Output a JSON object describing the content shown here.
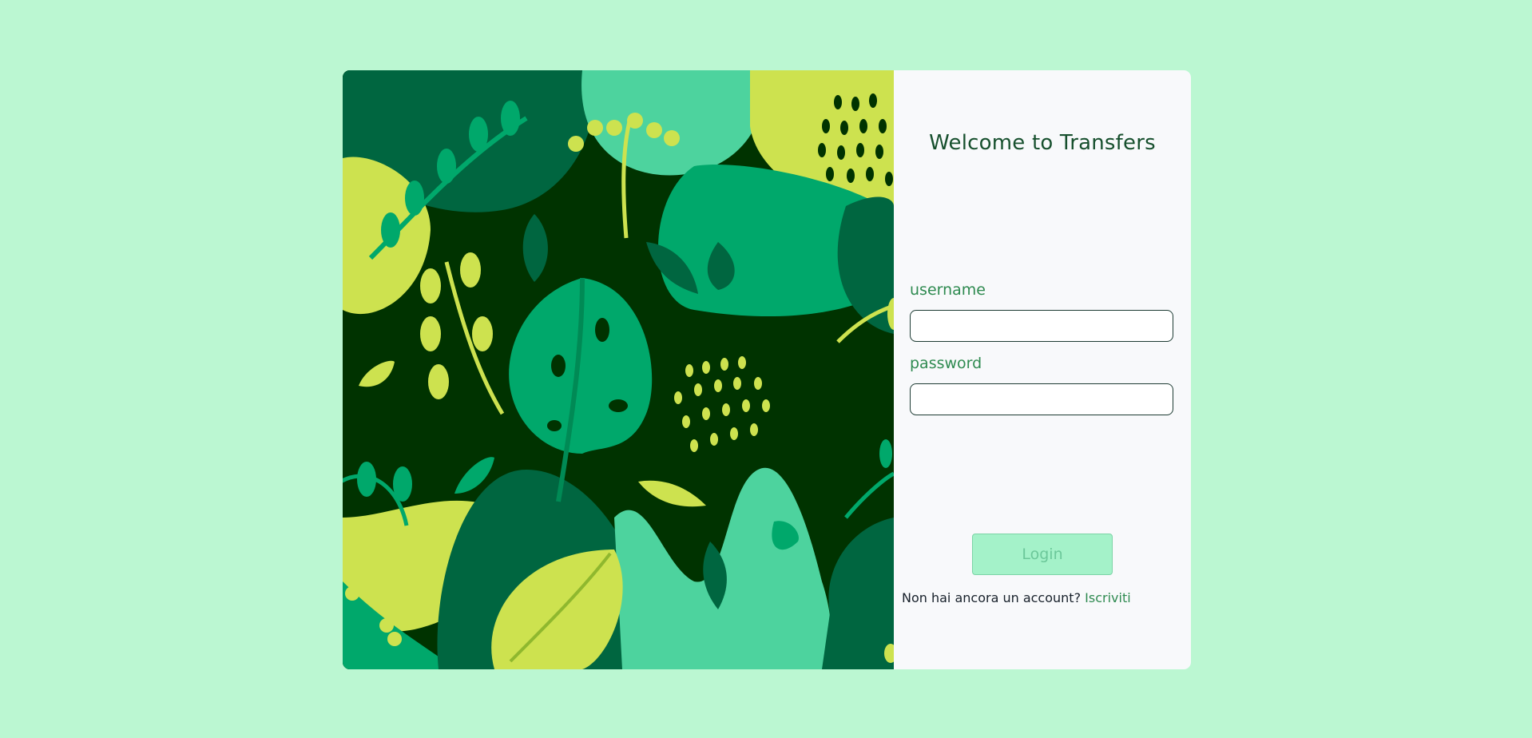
{
  "login": {
    "title": "Welcome to Transfers",
    "username_label": "username",
    "username_value": "",
    "password_label": "password",
    "password_value": "",
    "login_button": "Login",
    "signup_prompt": "Non hai ancora un account?",
    "signup_link": "Iscriviti"
  },
  "colors": {
    "page_background": "#bbf7d2",
    "panel_background": "#f8f9fb",
    "title": "#17502e",
    "label": "#2e8a50",
    "button_background": "#a4f2c9"
  },
  "illustration": {
    "description_icon": "tropical-leaves-illustration"
  }
}
